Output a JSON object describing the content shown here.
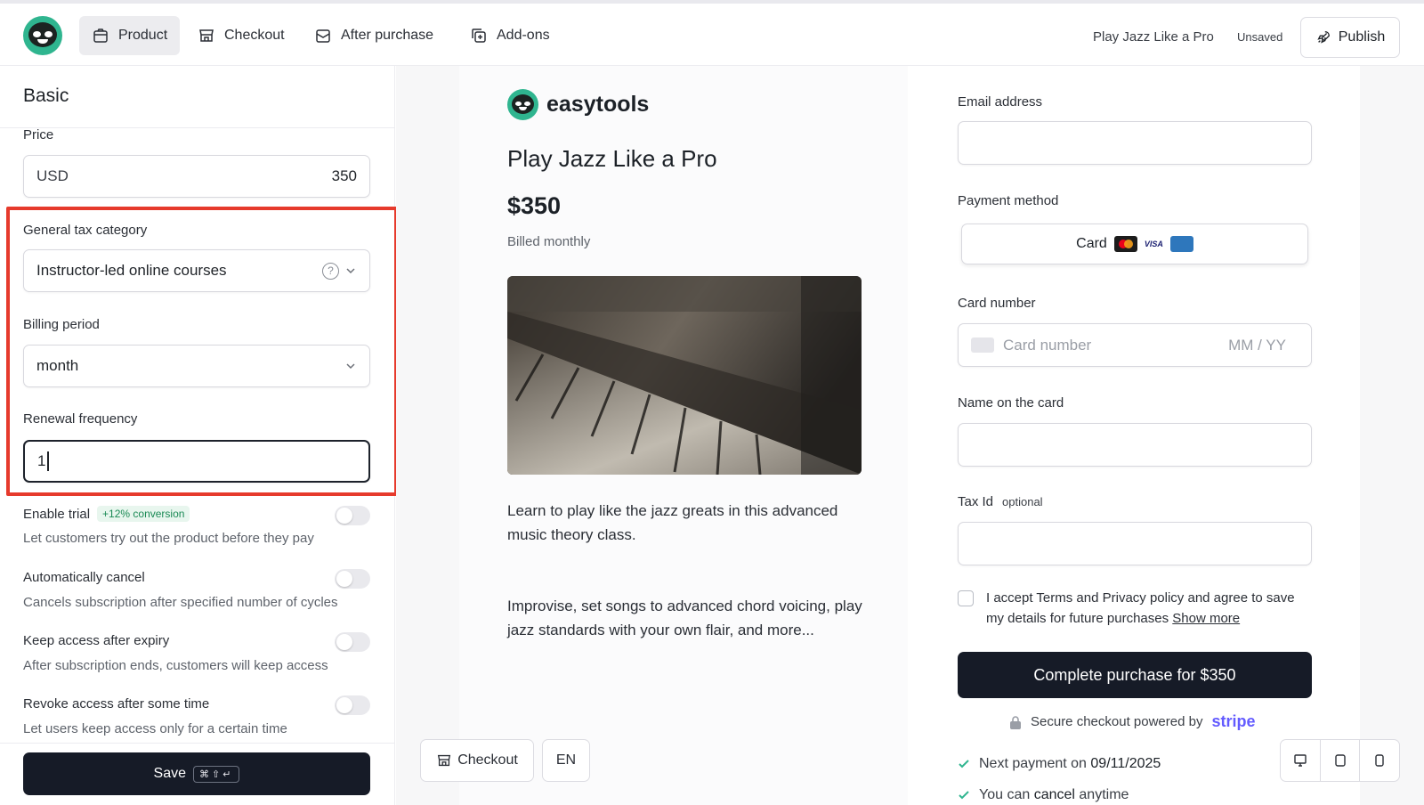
{
  "topbar": {
    "tabs": [
      {
        "label": "Product",
        "icon": "box-icon",
        "active": true
      },
      {
        "label": "Checkout",
        "icon": "store-icon",
        "active": false
      },
      {
        "label": "After purchase",
        "icon": "mail-icon",
        "active": false
      },
      {
        "label": "Add-ons",
        "icon": "copy-plus-icon",
        "active": false
      }
    ],
    "document_title": "Play Jazz Like a Pro",
    "status": "Unsaved",
    "publish_label": "Publish"
  },
  "left_panel": {
    "section_title": "Basic",
    "price": {
      "label": "Price",
      "currency": "USD",
      "value": "350"
    },
    "tax": {
      "label": "General tax category",
      "value": "Instructor-led online courses"
    },
    "billing": {
      "label": "Billing period",
      "value": "month"
    },
    "renewal": {
      "label": "Renewal frequency",
      "value": "1"
    },
    "toggles": [
      {
        "title": "Enable trial",
        "badge": "+12% conversion",
        "desc": "Let customers try out the product before they pay",
        "on": false
      },
      {
        "title": "Automatically cancel",
        "badge": "",
        "desc": "Cancels subscription after specified number of cycles",
        "on": false
      },
      {
        "title": "Keep access after expiry",
        "badge": "",
        "desc": "After subscription ends, customers will keep access",
        "on": false
      },
      {
        "title": "Revoke access after some time",
        "badge": "",
        "desc": "Let users keep access only for a certain time",
        "on": false
      }
    ],
    "save_label": "Save",
    "save_shortcut": "⌘⇧↵"
  },
  "preview": {
    "brand": "easytools",
    "title": "Play Jazz Like a Pro",
    "price": "$350",
    "billed": "Billed monthly",
    "desc1": "Learn to play like the jazz greats in this advanced music theory class.",
    "desc2": "Improvise, set songs to advanced chord voicing, play jazz standards with your own flair, and more...",
    "checkout_btn": "Checkout",
    "lang_btn": "EN"
  },
  "checkout_form": {
    "email_label": "Email address",
    "payment_label": "Payment method",
    "payment_value": "Card",
    "card_label": "Card number",
    "card_placeholder": "Card number",
    "expiry_placeholder": "MM / YY",
    "name_label": "Name on the card",
    "tax_label": "Tax Id",
    "tax_optional": "optional",
    "terms_text": "I accept Terms and Privacy policy and agree to save my details for future purchases",
    "show_more": "Show more",
    "complete_label": "Complete purchase for $350",
    "secure_text": "Secure checkout powered by",
    "stripe": "stripe",
    "next_payment_prefix": "Next payment on",
    "next_payment_date": "09/11/2025",
    "cancel_prefix": "You can",
    "cancel_word": "cancel",
    "cancel_suffix": "anytime"
  },
  "colors": {
    "accent_green": "#2fb58f",
    "dark": "#161b27",
    "highlight_red": "#e63a2c",
    "stripe": "#635bff"
  }
}
